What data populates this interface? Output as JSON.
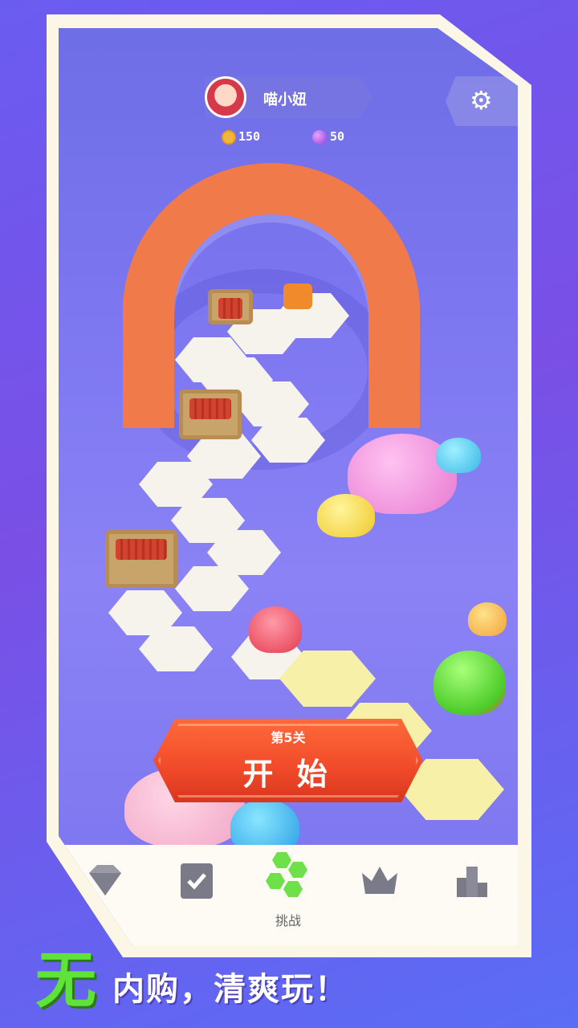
{
  "header": {
    "username": "喵小妞",
    "coins": "150",
    "gems": "50"
  },
  "level": {
    "label": "第5关",
    "start_label": "开 始"
  },
  "tabs": [
    {
      "icon": "diamond-icon"
    },
    {
      "icon": "task-book-icon"
    },
    {
      "icon": "hex-challenge-icon",
      "label": "挑战",
      "active": true
    },
    {
      "icon": "crown-icon"
    },
    {
      "icon": "leaderboard-icon"
    }
  ],
  "slogan": {
    "big": "无",
    "rest": "内购，清爽玩！"
  },
  "colors": {
    "start_button": "#f04a2a",
    "slogan_accent": "#5fe23a",
    "background": "#6b5cf0"
  }
}
